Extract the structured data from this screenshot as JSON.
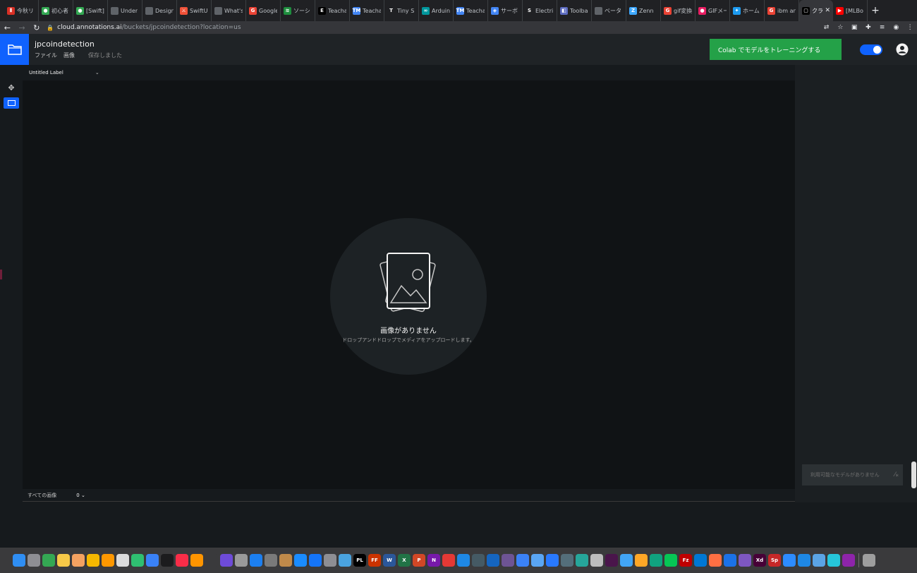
{
  "browser": {
    "tabs": [
      {
        "label": "今秋リ",
        "icon": "qiita-icon",
        "color": "#d93025",
        "glyph": "⫴"
      },
      {
        "label": "初心者",
        "icon": "green-circle-icon",
        "color": "#34a853",
        "glyph": "●"
      },
      {
        "label": "[Swift]",
        "icon": "green-circle-icon",
        "color": "#34a853",
        "glyph": "●"
      },
      {
        "label": "Under",
        "icon": "apple-icon",
        "color": "#5f6368",
        "glyph": ""
      },
      {
        "label": "Design",
        "icon": "apple-icon",
        "color": "#5f6368",
        "glyph": ""
      },
      {
        "label": "SwiftU",
        "icon": "swift-icon",
        "color": "#f05138",
        "glyph": "⚔"
      },
      {
        "label": "What's",
        "icon": "apple-icon",
        "color": "#5f6368",
        "glyph": ""
      },
      {
        "label": "Google",
        "icon": "google-icon",
        "color": "#ea4335",
        "glyph": "G"
      },
      {
        "label": "ソーシ",
        "icon": "stripes-icon",
        "color": "#1e8e3e",
        "glyph": "≋"
      },
      {
        "label": "Teacha",
        "icon": "e-icon",
        "color": "#000000",
        "glyph": "E"
      },
      {
        "label": "Teacha",
        "icon": "tm-icon",
        "color": "#4285f4",
        "glyph": "TM"
      },
      {
        "label": "Tiny S",
        "icon": "tiny-icon",
        "color": "#202124",
        "glyph": "T"
      },
      {
        "label": "Arduin",
        "icon": "arduino-icon",
        "color": "#00979d",
        "glyph": "∞"
      },
      {
        "label": "Teacha",
        "icon": "tm-icon",
        "color": "#4285f4",
        "glyph": "TM"
      },
      {
        "label": "サーボ",
        "icon": "layers-icon",
        "color": "#4285f4",
        "glyph": "◈"
      },
      {
        "label": "Electri",
        "icon": "s-icon",
        "color": "#202124",
        "glyph": "S"
      },
      {
        "label": "Toolba",
        "icon": "toolbar-icon",
        "color": "#5c6bc0",
        "glyph": "◧"
      },
      {
        "label": "ベータ",
        "icon": "apple-icon",
        "color": "#5f6368",
        "glyph": ""
      },
      {
        "label": "Zenn",
        "icon": "zenn-icon",
        "color": "#3ea8ff",
        "glyph": "Z"
      },
      {
        "label": "gif変換",
        "icon": "google-icon",
        "color": "#ea4335",
        "glyph": "G"
      },
      {
        "label": "GIFメー",
        "icon": "gif-icon",
        "color": "#e91e63",
        "glyph": "●"
      },
      {
        "label": "ホーム",
        "icon": "twitter-icon",
        "color": "#1d9bf0",
        "glyph": "✦"
      },
      {
        "label": "ibm an",
        "icon": "google-icon",
        "color": "#ea4335",
        "glyph": "G"
      },
      {
        "label": "クラ",
        "icon": "annotations-icon",
        "color": "#000000",
        "glyph": "▢",
        "active": true
      },
      {
        "label": "[MLBo",
        "icon": "youtube-icon",
        "color": "#ff0000",
        "glyph": "▶"
      }
    ],
    "url_host": "cloud.annotations.ai",
    "url_path": "/buckets/jpcoindetection?location=us"
  },
  "header": {
    "title": "jpcoindetection",
    "menu": [
      "ファイル",
      "画像"
    ],
    "save_status": "保存しました",
    "train_button": "Colab でモデルをトレーニングする",
    "toggle_on": true
  },
  "toolbar": {
    "label_select": "Untitled Label"
  },
  "canvas": {
    "empty_title": "画像がありません",
    "empty_subtitle": "ドロップアンドドロップでメディアをアップロードします。"
  },
  "right_panel": {
    "model_placeholder": "利用可能なモデルがありません"
  },
  "filter_bar": {
    "filter_label": "すべての画像",
    "count": "0"
  },
  "colors": {
    "accent": "#0f62fe",
    "train_green": "#24a148",
    "canvas_bg": "#101315"
  },
  "dock": {
    "apps": [
      {
        "icon": "finder-icon",
        "color": "#2f8ef3"
      },
      {
        "icon": "launchpad-icon",
        "color": "#8e8e93"
      },
      {
        "icon": "chrome-icon",
        "color": "#34a853"
      },
      {
        "icon": "notes-icon",
        "color": "#f7c948"
      },
      {
        "icon": "photos-icon",
        "color": "#f4a261"
      },
      {
        "icon": "lightbulb-icon",
        "color": "#f5b800"
      },
      {
        "icon": "sublime-icon",
        "color": "#ff9800"
      },
      {
        "icon": "script-icon",
        "color": "#dcdcdc"
      },
      {
        "icon": "numbers-icon",
        "color": "#2fbf71"
      },
      {
        "icon": "keynote-icon",
        "color": "#3a82f7"
      },
      {
        "icon": "terminal-icon",
        "color": "#1c1c1e"
      },
      {
        "icon": "music-icon",
        "color": "#fa2d48"
      },
      {
        "icon": "books-icon",
        "color": "#ff9500"
      },
      {
        "icon": "video-icon",
        "color": "#3a3a3c"
      },
      {
        "icon": "fcp-icon",
        "color": "#6e4bd8"
      },
      {
        "icon": "preview-icon",
        "color": "#9a9a9a"
      },
      {
        "icon": "xcode-icon",
        "color": "#1c7ff0"
      },
      {
        "icon": "raccoon-icon",
        "color": "#7a7a7a"
      },
      {
        "icon": "archive-icon",
        "color": "#c08a4a"
      },
      {
        "icon": "appstore-icon",
        "color": "#1a8cff"
      },
      {
        "icon": "xcode-blue-icon",
        "color": "#1575f9"
      },
      {
        "icon": "settings-icon",
        "color": "#8e8e93"
      },
      {
        "icon": "network-icon",
        "color": "#4aa3df"
      },
      {
        "icon": "pl-icon",
        "color": "#000000",
        "glyph": "PL"
      },
      {
        "icon": "ff-icon",
        "color": "#cc3300",
        "glyph": "FF"
      },
      {
        "icon": "word-icon",
        "color": "#2b579a",
        "glyph": "W"
      },
      {
        "icon": "excel-icon",
        "color": "#217346",
        "glyph": "X"
      },
      {
        "icon": "powerpoint-icon",
        "color": "#d24726",
        "glyph": "P"
      },
      {
        "icon": "onenote-icon",
        "color": "#7719aa",
        "glyph": "N"
      },
      {
        "icon": "star-icon",
        "color": "#e53935"
      },
      {
        "icon": "safari-icon",
        "color": "#1e88e5"
      },
      {
        "icon": "globe-icon",
        "color": "#455a64"
      },
      {
        "icon": "maps-icon",
        "color": "#1565c0"
      },
      {
        "icon": "github-icon",
        "color": "#6e5494"
      },
      {
        "icon": "swift-play-icon",
        "color": "#3b82f6"
      },
      {
        "icon": "sketch-icon",
        "color": "#5aa6f4"
      },
      {
        "icon": "upload-icon",
        "color": "#2979ff"
      },
      {
        "icon": "network2-icon",
        "color": "#546e7a"
      },
      {
        "icon": "sourcetree-icon",
        "color": "#26a69a"
      },
      {
        "icon": "book-icon",
        "color": "#bdbdbd"
      },
      {
        "icon": "slack-icon",
        "color": "#4a154b"
      },
      {
        "icon": "globe2-icon",
        "color": "#42a5f5"
      },
      {
        "icon": "pencil-icon",
        "color": "#ffa726"
      },
      {
        "icon": "chatgpt-icon",
        "color": "#10a37f"
      },
      {
        "icon": "line-icon",
        "color": "#06c755"
      },
      {
        "icon": "filezilla-icon",
        "color": "#bf0000",
        "glyph": "Fz"
      },
      {
        "icon": "window-icon",
        "color": "#0078d4"
      },
      {
        "icon": "fold-icon",
        "color": "#ff7043"
      },
      {
        "icon": "affinity-icon",
        "color": "#1b72e8"
      },
      {
        "icon": "affinity2-icon",
        "color": "#7e57c2"
      },
      {
        "icon": "xd-icon",
        "color": "#470137",
        "glyph": "Xd"
      },
      {
        "icon": "speedpro-icon",
        "color": "#c62828",
        "glyph": "Sp"
      },
      {
        "icon": "zoom-icon",
        "color": "#2d8cff"
      },
      {
        "icon": "safari2-icon",
        "color": "#1e88e5"
      },
      {
        "icon": "folder-icon",
        "color": "#5ba4e5"
      },
      {
        "icon": "globe3-icon",
        "color": "#26c6da"
      },
      {
        "icon": "stack-icon",
        "color": "#8e24aa"
      },
      {
        "icon": "trash-icon",
        "color": "#9e9e9e"
      }
    ]
  }
}
